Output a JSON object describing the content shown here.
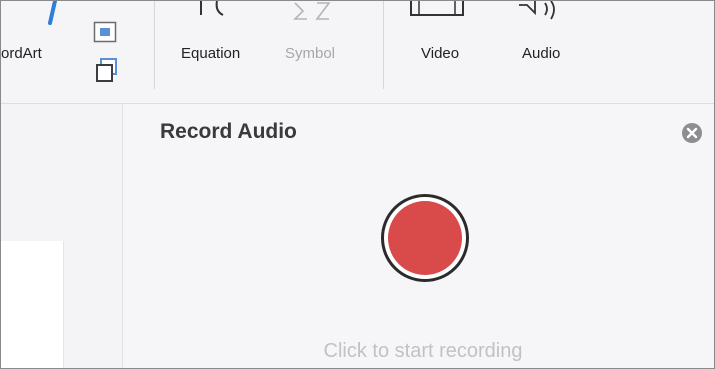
{
  "ribbon": {
    "wordart_label": "ordArt",
    "equation_label": "Equation",
    "symbol_label": "Symbol",
    "video_label": "Video",
    "audio_label": "Audio"
  },
  "panel": {
    "title": "Record Audio",
    "hint": "Click to start recording"
  },
  "colors": {
    "record_red": "#d94a4b",
    "accent_blue": "#2f7fd8"
  },
  "icons": [
    "wordart-icon",
    "text-box-icon",
    "arrange-icon",
    "equation-icon",
    "symbol-icon",
    "video-icon",
    "audio-icon",
    "close-icon",
    "record-icon"
  ]
}
